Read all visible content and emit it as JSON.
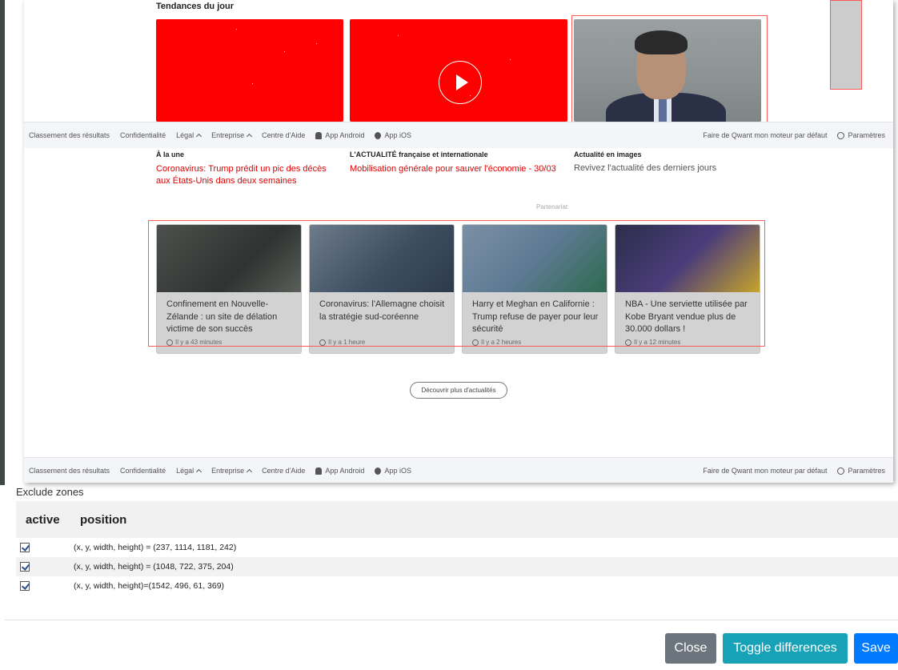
{
  "preview": {
    "trends_title": "Tendances du jour",
    "footer": {
      "items": [
        "Classement des résultats",
        "Confidentialité",
        "Légal",
        "Entreprise",
        "Centre d'Aide",
        "App Android",
        "App iOS"
      ],
      "right_items": [
        "Faire de Qwant mon moteur par défaut",
        "Paramètres"
      ]
    },
    "headlines": {
      "col1_title": "À la une",
      "col1_text": "Coronavirus: Trump prédit un pic des décès aux États-Unis dans deux semaines",
      "col2_title": "L'ACTUALITÉ française et internationale",
      "col2_text": "Mobilisation générale pour sauver l'économie - 30/03",
      "col3_title": "Actualité en images",
      "col3_text": "Revivez l'actualité des derniers jours"
    },
    "partenariat": "Partenariat",
    "news": [
      {
        "title": "Confinement en Nouvelle-Zélande : un site de délation victime de son succès",
        "time": "Il y a 43 minutes"
      },
      {
        "title": "Coronavirus: l'Allemagne choisit la stratégie sud-coréenne",
        "time": "Il y a 1 heure"
      },
      {
        "title": "Harry et Meghan en Californie : Trump refuse de payer pour leur sécurité",
        "time": "Il y a 2 heures"
      },
      {
        "title": "NBA - Une serviette utilisée par Kobe Bryant vendue plus de 30.000 dollars !",
        "time": "Il y a 12 minutes"
      }
    ],
    "discover_button": "Découvrir plus d'actualités"
  },
  "exclude_zones": {
    "title": "Exclude zones",
    "headers": {
      "active": "active",
      "position": "position"
    },
    "rows": [
      {
        "active": true,
        "position": "(x, y, width, height) = (237, 1114, 1181, 242)"
      },
      {
        "active": true,
        "position": "(x, y, width, height) = (1048, 722, 375, 204)"
      },
      {
        "active": true,
        "position": "(x, y, width, height)=(1542, 496, 61, 369)"
      }
    ]
  },
  "buttons": {
    "close": "Close",
    "toggle": "Toggle differences",
    "save": "Save"
  },
  "colors": {
    "diff_red": "#ff0000",
    "close_btn": "#6c757d",
    "toggle_btn": "#17a2b8",
    "save_btn": "#007bff"
  }
}
